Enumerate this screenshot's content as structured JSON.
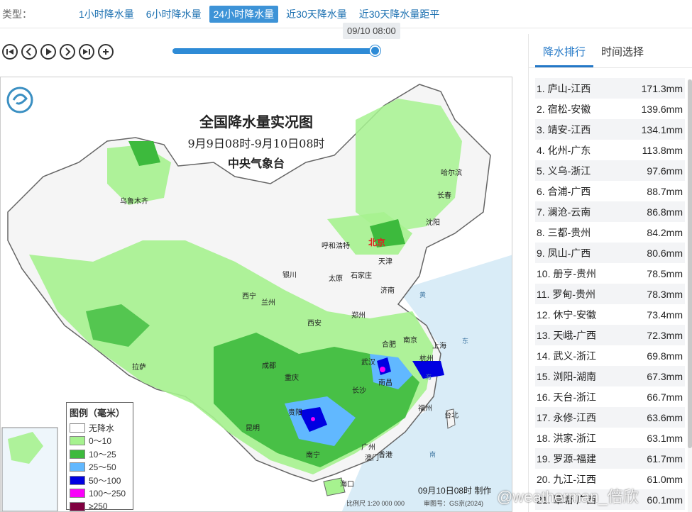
{
  "topbar": {
    "type_label": "类型：",
    "tabs": [
      {
        "label": "1小时降水量",
        "active": false
      },
      {
        "label": "6小时降水量",
        "active": false
      },
      {
        "label": "24小时降水量",
        "active": true
      },
      {
        "label": "近30天降水量",
        "active": false
      },
      {
        "label": "近30天降水量距平",
        "active": false
      }
    ]
  },
  "player": {
    "current_time": "09/10 08:00",
    "progress": 1.0,
    "buttons": [
      "skip-first-icon",
      "prev-icon",
      "play-icon",
      "next-icon",
      "skip-last-icon",
      "zoom-in-icon"
    ]
  },
  "map": {
    "title": "全国降水量实况图",
    "subtitle": "9月9日08时-9月10日08时",
    "agency": "中央气象台",
    "made_time": "09月10日08时 制作",
    "scale": "比例尺 1:20 000 000",
    "review_no": "审图号：GS京(2024)",
    "legend_title": "图例（毫米）",
    "legend": [
      {
        "label": "无降水",
        "color": "#ffffff"
      },
      {
        "label": "0～10",
        "color": "#a6f28f"
      },
      {
        "label": "10～25",
        "color": "#3dba3d"
      },
      {
        "label": "25～50",
        "color": "#61b8ff"
      },
      {
        "label": "50～100",
        "color": "#0000e1"
      },
      {
        "label": "100～250",
        "color": "#fa00fa"
      },
      {
        "label": "≥250",
        "color": "#800040"
      }
    ],
    "cities": [
      {
        "name": "乌鲁木齐"
      },
      {
        "name": "哈尔滨"
      },
      {
        "name": "长春"
      },
      {
        "name": "沈阳"
      },
      {
        "name": "呼和浩特"
      },
      {
        "name": "北京"
      },
      {
        "name": "天津"
      },
      {
        "name": "银川"
      },
      {
        "name": "太原"
      },
      {
        "name": "石家庄"
      },
      {
        "name": "济南"
      },
      {
        "name": "西宁"
      },
      {
        "name": "兰州"
      },
      {
        "name": "郑州"
      },
      {
        "name": "西安"
      },
      {
        "name": "合肥"
      },
      {
        "name": "南京"
      },
      {
        "name": "上海"
      },
      {
        "name": "拉萨"
      },
      {
        "name": "成都"
      },
      {
        "name": "武汉"
      },
      {
        "name": "杭州"
      },
      {
        "name": "重庆"
      },
      {
        "name": "南昌"
      },
      {
        "name": "长沙"
      },
      {
        "name": "贵阳"
      },
      {
        "name": "福州"
      },
      {
        "name": "台北"
      },
      {
        "name": "昆明"
      },
      {
        "name": "南宁"
      },
      {
        "name": "广州"
      },
      {
        "name": "香港"
      },
      {
        "name": "澳门"
      },
      {
        "name": "海口"
      }
    ],
    "sea_labels": [
      "黄",
      "东",
      "海",
      "南"
    ]
  },
  "ranking": {
    "tabs": [
      {
        "label": "降水排行",
        "active": true
      },
      {
        "label": "时间选择",
        "active": false
      }
    ],
    "rows": [
      {
        "name": "1. 庐山-江西",
        "value": "171.3mm"
      },
      {
        "name": "2. 宿松-安徽",
        "value": "139.6mm"
      },
      {
        "name": "3. 靖安-江西",
        "value": "134.1mm"
      },
      {
        "name": "4. 化州-广东",
        "value": "113.8mm"
      },
      {
        "name": "5. 义乌-浙江",
        "value": "97.6mm"
      },
      {
        "name": "6. 合浦-广西",
        "value": "88.7mm"
      },
      {
        "name": "7. 澜沧-云南",
        "value": "86.8mm"
      },
      {
        "name": "8. 三都-贵州",
        "value": "84.2mm"
      },
      {
        "name": "9. 凤山-广西",
        "value": "80.6mm"
      },
      {
        "name": "10. 册亨-贵州",
        "value": "78.5mm"
      },
      {
        "name": "11. 罗甸-贵州",
        "value": "78.3mm"
      },
      {
        "name": "12. 休宁-安徽",
        "value": "73.4mm"
      },
      {
        "name": "13. 天峨-广西",
        "value": "72.3mm"
      },
      {
        "name": "14. 武义-浙江",
        "value": "69.8mm"
      },
      {
        "name": "15. 浏阳-湖南",
        "value": "67.3mm"
      },
      {
        "name": "16. 天台-浙江",
        "value": "66.7mm"
      },
      {
        "name": "17. 永修-江西",
        "value": "63.6mm"
      },
      {
        "name": "18. 洪家-浙江",
        "value": "63.1mm"
      },
      {
        "name": "19. 罗源-福建",
        "value": "61.7mm"
      },
      {
        "name": "20. 九江-江西",
        "value": "61.0mm"
      },
      {
        "name": "21. 覃塘-广西",
        "value": "60.1mm"
      }
    ]
  },
  "watermark": "@weatherman_倍欣"
}
